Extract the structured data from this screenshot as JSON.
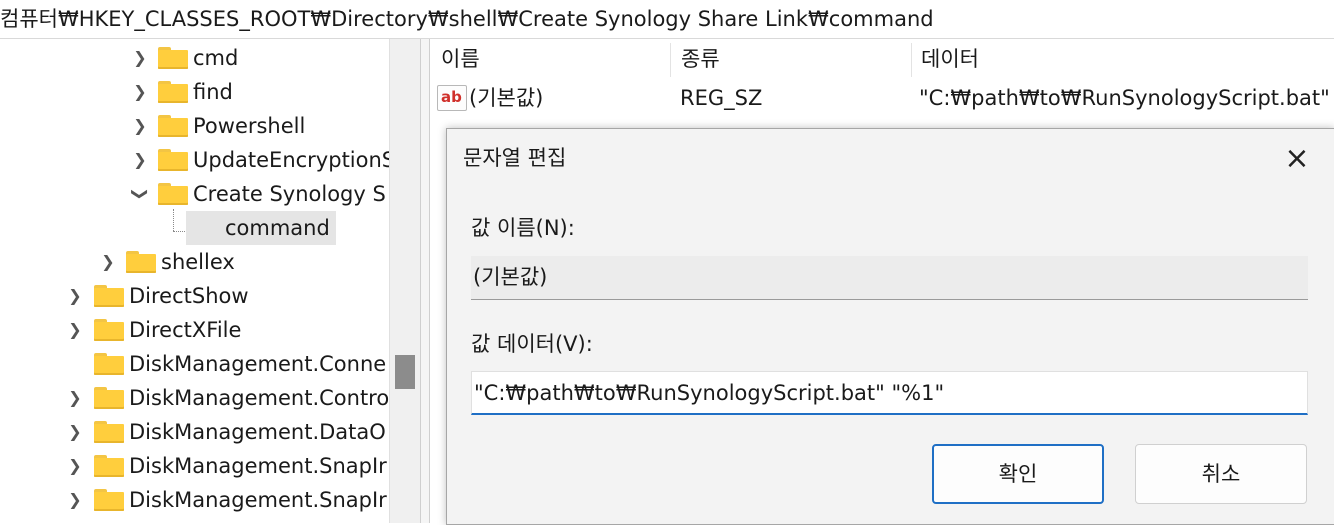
{
  "address_bar": {
    "path": "컴퓨터₩HKEY_CLASSES_ROOT₩Directory₩shell₩Create Synology Share Link₩command"
  },
  "tree": {
    "items": [
      {
        "label": "cmd",
        "expanded": false
      },
      {
        "label": "find",
        "expanded": false
      },
      {
        "label": "Powershell",
        "expanded": false
      },
      {
        "label": "UpdateEncryptionS",
        "expanded": false
      },
      {
        "label": "Create Synology S",
        "expanded": true
      },
      {
        "label": "command",
        "selected": true
      },
      {
        "label": "shellex",
        "expanded": false
      },
      {
        "label": "DirectShow",
        "expanded": false
      },
      {
        "label": "DirectXFile",
        "expanded": false
      },
      {
        "label": "DiskManagement.Conne",
        "expanded": false
      },
      {
        "label": "DiskManagement.Contro",
        "expanded": false
      },
      {
        "label": "DiskManagement.DataO",
        "expanded": false
      },
      {
        "label": "DiskManagement.SnapIr",
        "expanded": false
      },
      {
        "label": "DiskManagement.SnapIr",
        "expanded": false
      }
    ]
  },
  "values_list": {
    "headers": {
      "name": "이름",
      "type": "종류",
      "data": "데이터"
    },
    "rows": [
      {
        "icon": "string-value-icon",
        "icon_text": "ab",
        "name": "(기본값)",
        "type": "REG_SZ",
        "data": "\"C:₩path₩to₩RunSynologyScript.bat\" \""
      }
    ]
  },
  "dialog": {
    "title": "문자열 편집",
    "close_icon": "×",
    "name_label": "값 이름(N):",
    "name_value": "(기본값)",
    "data_label": "값 데이터(V):",
    "data_value": "\"C:₩path₩to₩RunSynologyScript.bat\" \"%1\"",
    "ok_label": "확인",
    "cancel_label": "취소"
  },
  "colors": {
    "accent": "#1f6fc5",
    "folder": "#ffce3d",
    "selection": "#e5e5e5"
  }
}
